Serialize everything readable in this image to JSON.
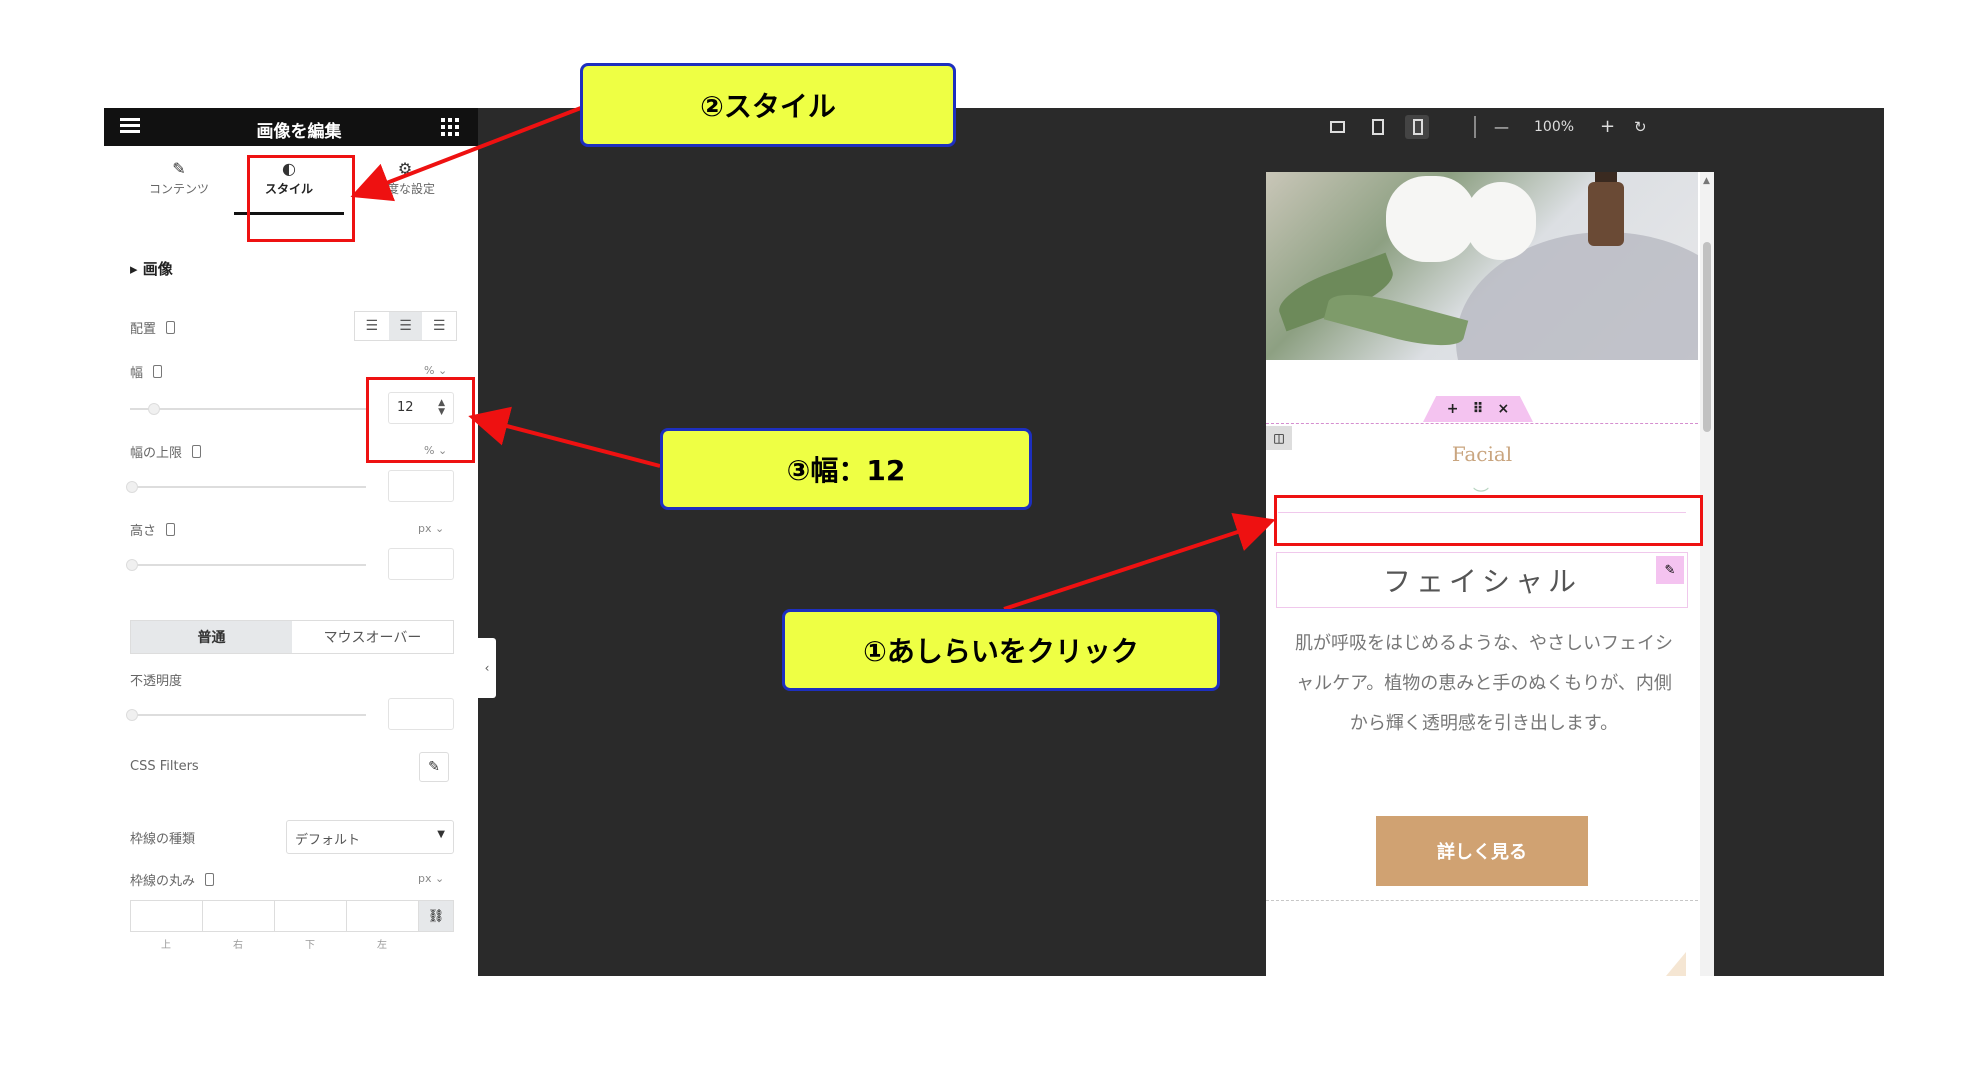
{
  "panel": {
    "title": "画像を編集",
    "tabs": [
      {
        "label": "コンテンツ",
        "icon": "pencil-icon"
      },
      {
        "label": "スタイル",
        "icon": "contrast-icon"
      },
      {
        "label": "高度な設定",
        "icon": "gear-icon"
      }
    ],
    "section_title": "画像",
    "align_label": "配置",
    "width_label": "幅",
    "width_unit": "% ⌄",
    "width_value": "12",
    "maxwidth_label": "幅の上限",
    "maxwidth_unit": "% ⌄",
    "height_label": "高さ",
    "height_unit": "px ⌄",
    "state_tabs": [
      "普通",
      "マウスオーバー"
    ],
    "opacity_label": "不透明度",
    "css_filters_label": "CSS Filters",
    "border_type_label": "枠線の種類",
    "border_type_value": "デフォルト",
    "border_radius_label": "枠線の丸み",
    "border_radius_unit": "px ⌄",
    "dim_labels": [
      "上",
      "右",
      "下",
      "左"
    ]
  },
  "toolbar": {
    "zoom": "100%",
    "minus": "—",
    "plus": "+",
    "undo": "↻"
  },
  "preview": {
    "handle_plus": "+",
    "handle_move": "⠿",
    "handle_close": "×",
    "subtitle": "Facial",
    "heading": "フェイシャル",
    "body": "肌が呼吸をはじめるような、やさしいフェイシャルケア。植物の恵みと手のぬくもりが、内側から輝く透明感を引き出します。",
    "button": "詳しく見る"
  },
  "annotations": {
    "callout_style": "②スタイル",
    "callout_width": "③幅：12",
    "callout_click": "①あしらいをクリック"
  },
  "colors": {
    "accent_red": "#ee1111",
    "callout_fill": "#eeff44",
    "callout_border": "#1d2fbf",
    "button": "#d0a272",
    "selection": "#f4c3f0"
  }
}
